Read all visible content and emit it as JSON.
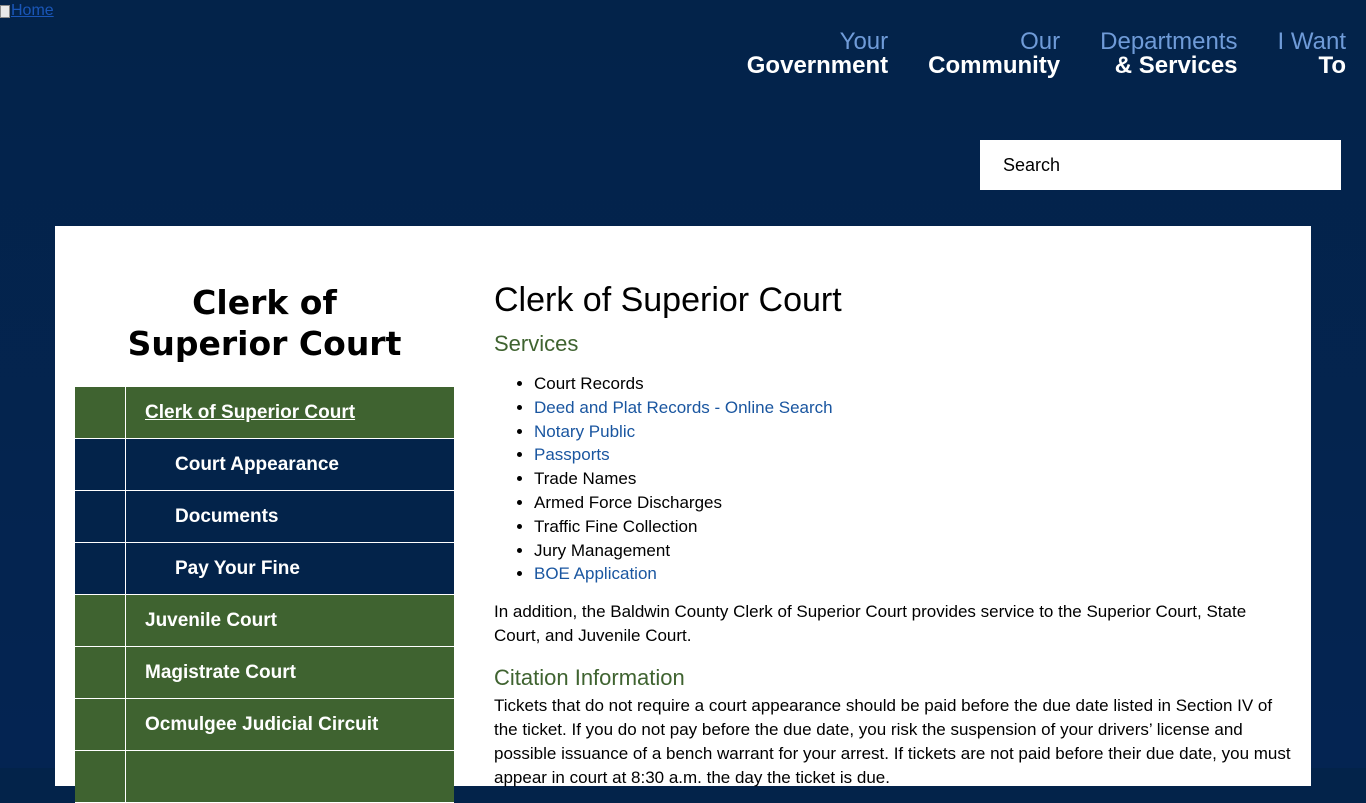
{
  "header": {
    "home_link_text": "Home",
    "nav": [
      {
        "top": "Your",
        "bottom": "Government"
      },
      {
        "top": "Our",
        "bottom": "Community"
      },
      {
        "top": "Departments",
        "bottom": "& Services"
      },
      {
        "top": "I Want",
        "bottom": "To"
      }
    ],
    "search_placeholder": "Search"
  },
  "sidebar": {
    "title": "Clerk of Superior Court",
    "items": [
      {
        "label": "Clerk of Superior Court"
      },
      {
        "label": "Court Appearance"
      },
      {
        "label": "Documents"
      },
      {
        "label": "Pay Your Fine"
      },
      {
        "label": "Juvenile Court"
      },
      {
        "label": "Magistrate Court"
      },
      {
        "label": "Ocmulgee Judicial Circuit"
      }
    ]
  },
  "main": {
    "title": "Clerk of Superior Court",
    "services_heading": "Services",
    "services": [
      {
        "text": "Court Records"
      },
      {
        "text": "Deed and Plat Records - Online Search"
      },
      {
        "text": "Notary Public"
      },
      {
        "text": "Passports"
      },
      {
        "text": "Trade Names"
      },
      {
        "text": "Armed Force Discharges"
      },
      {
        "text": "Traffic Fine Collection"
      },
      {
        "text": "Jury Management"
      },
      {
        "text": "BOE Application"
      }
    ],
    "intro_paragraph": "In addition, the Baldwin County Clerk of Superior Court provides service to the Superior Court, State Court, and Juvenile Court.",
    "citation_heading": "Citation Information",
    "citation_paragraph": "Tickets that do not require a court appearance should be paid before the due date listed in Section IV of the ticket. If you do not pay before the due date, you risk the suspension of your drivers’ license and possible issuance of a bench warrant for your arrest. If tickets are not paid before their due date, you must appear in court at 8:30 a.m. the day the ticket is due."
  },
  "colors": {
    "header_background": "#03234a",
    "nav_top_text": "#6f9bd8",
    "sidebar_green": "#3f6330",
    "sidebar_navy": "#03234a",
    "link_blue": "#1a56a0",
    "section_heading_green": "#3f6330"
  }
}
